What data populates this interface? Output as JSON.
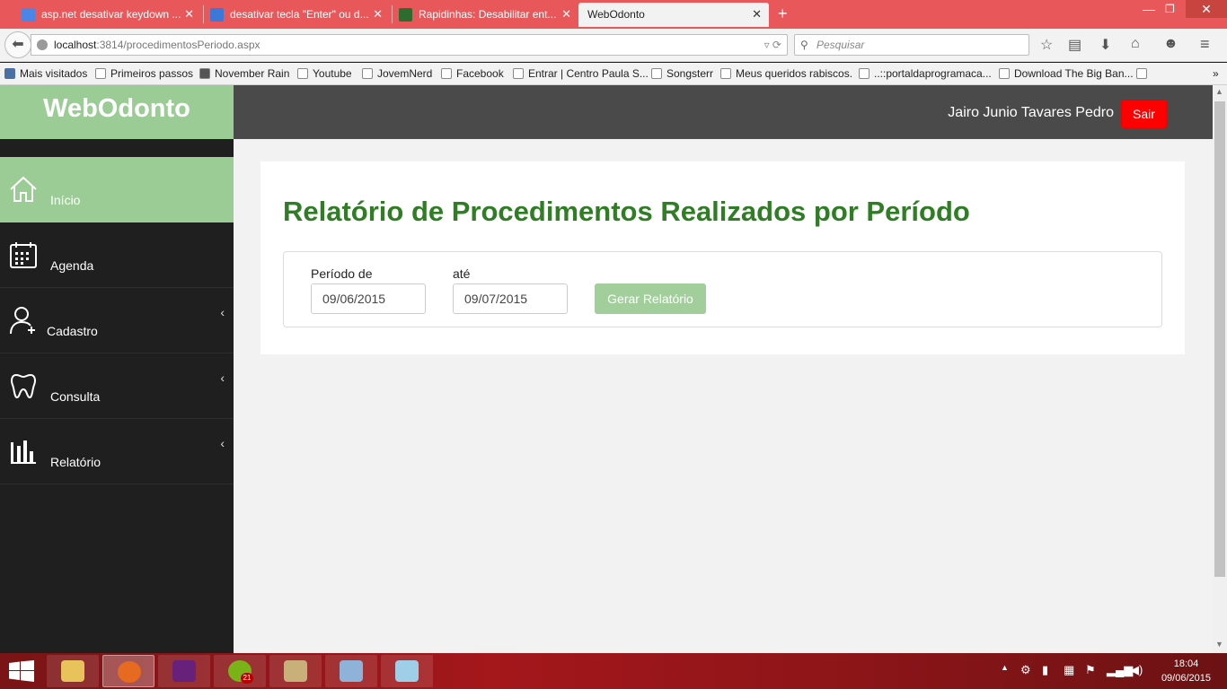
{
  "browser": {
    "tabs": [
      {
        "title": "asp.net desativar keydown ...",
        "icon": "google-icon"
      },
      {
        "title": "desativar tecla \"Enter\" ou d...",
        "icon": "pen-icon"
      },
      {
        "title": "Rapidinhas: Desabilitar ent...",
        "icon": "blog-icon"
      },
      {
        "title": "WebOdonto",
        "icon": "none",
        "active": true
      }
    ],
    "url_host": "localhost",
    "url_rest": ":3814/procedimentosPeriodo.aspx",
    "search_placeholder": "Pesquisar",
    "bookmarks": [
      "Mais visitados",
      "Primeiros passos",
      "November Rain",
      "Youtube",
      "JovemNerd",
      "Facebook",
      "Entrar | Centro Paula S...",
      "Songsterr",
      "Meus queridos rabiscos.",
      "..::portaldaprogramaca...",
      "Download The Big Ban..."
    ]
  },
  "app": {
    "brand": "WebOdonto",
    "user_name": "Jairo Junio Tavares Pedro",
    "logout_label": "Sair",
    "accent_color": "#9ccc96",
    "sidebar": [
      {
        "label": "Início",
        "icon": "home-icon",
        "active": true
      },
      {
        "label": "Agenda",
        "icon": "calendar-icon"
      },
      {
        "label": "Cadastro",
        "icon": "add-user-icon",
        "expandable": true
      },
      {
        "label": "Consulta",
        "icon": "tooth-icon",
        "expandable": true
      },
      {
        "label": "Relatório",
        "icon": "bar-chart-icon",
        "expandable": true
      }
    ],
    "page_title": "Relatório de Procedimentos Realizados por Período",
    "form": {
      "from_label": "Período de",
      "from_value": "09/06/2015",
      "to_label": "até",
      "to_value": "09/07/2015",
      "submit_label": "Gerar Relatório"
    }
  },
  "taskbar": {
    "time": "18:04",
    "date": "09/06/2015",
    "spotify_badge": "21"
  }
}
